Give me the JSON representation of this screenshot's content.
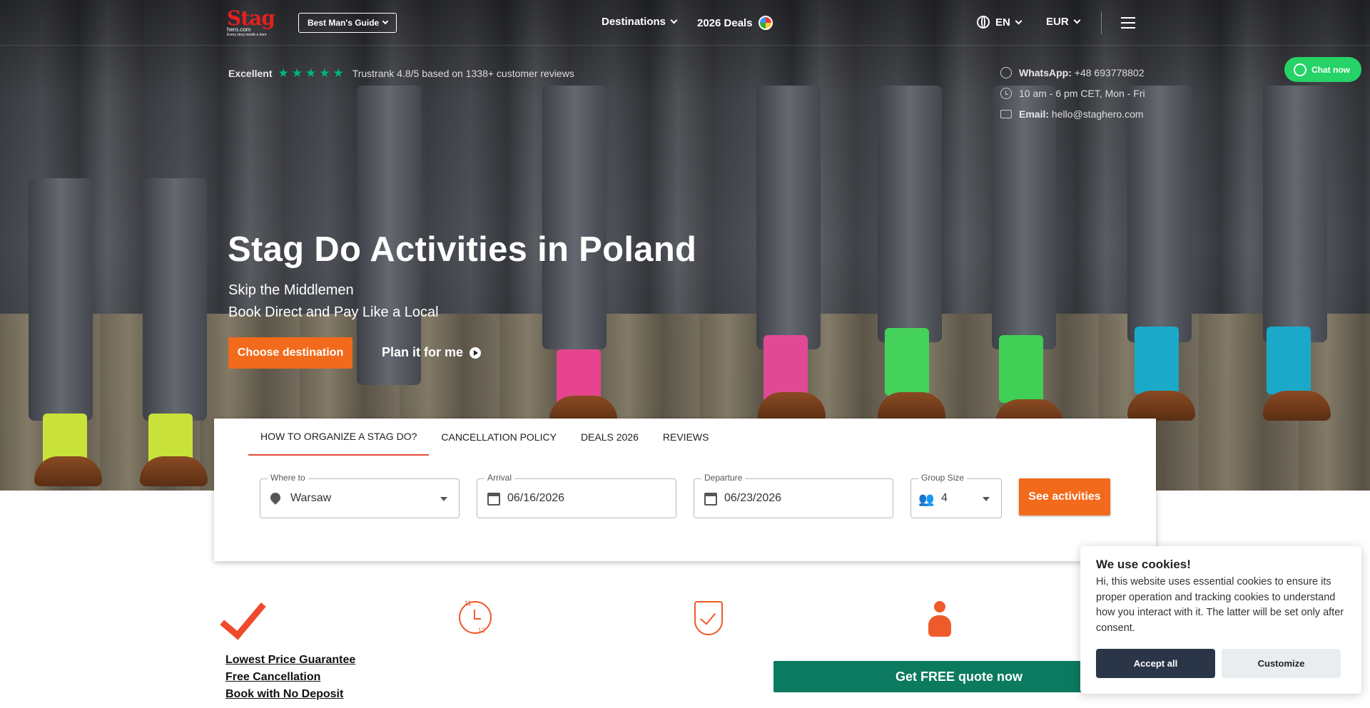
{
  "header": {
    "logo_text": "Stag",
    "logo_domain": "hero.com",
    "logo_tagline": "Every story needs a hero",
    "guide_button": "Best Man's Guide",
    "nav": [
      {
        "label": "Destinations"
      },
      {
        "label": "2026 Deals"
      }
    ],
    "language": "EN",
    "currency": "EUR"
  },
  "trust": {
    "rating_word": "Excellent",
    "stars": "★★★★★",
    "text": "Trustrank 4.8/5 based on 1338+ customer reviews"
  },
  "contacts": {
    "whatsapp_label": "WhatsApp:",
    "whatsapp_number": "+48 693778802",
    "hours": "10 am - 6 pm CET, Mon - Fri",
    "email_label": "Email:",
    "email": "hello@staghero.com"
  },
  "chat": {
    "label": "Chat now"
  },
  "hero": {
    "title": "Stag Do Activities in Poland",
    "subtitle_line1": "Skip the Middlemen",
    "subtitle_line2": "Book Direct and Pay Like a Local",
    "cta": "Choose destination",
    "plan_link": "Plan it for me"
  },
  "search": {
    "tabs": [
      {
        "label": "HOW TO ORGANIZE A STAG DO?"
      },
      {
        "label": "CANCELLATION POLICY"
      },
      {
        "label": "DEALS 2026"
      },
      {
        "label": "REVIEWS"
      }
    ],
    "where_label": "Where to",
    "where_value": "Warsaw",
    "arrival_label": "Arrival",
    "arrival_value": "06/16/2026",
    "departure_label": "Departure",
    "departure_value": "06/23/2026",
    "group_label": "Group Size",
    "group_value": "4",
    "submit": "See activities"
  },
  "features": {
    "icon_clock_top": "11",
    "icon_clock_bottom": "12",
    "links": [
      "Lowest Price Guarantee",
      "Free Cancellation",
      "Book with No Deposit"
    ],
    "quote_button": "Get FREE quote now"
  },
  "cookie": {
    "title": "We use cookies!",
    "body": "Hi, this website uses essential cookies to ensure its proper operation and tracking cookies to understand how you interact with it. The latter will be set only after consent.",
    "accept": "Accept all",
    "customize": "Customize"
  },
  "colors": {
    "accent_orange": "#f26a1b",
    "trust_green": "#00b67a",
    "whatsapp_green": "#25d366",
    "quote_green": "#0b7a5f",
    "cookie_dark": "#2a3647"
  }
}
